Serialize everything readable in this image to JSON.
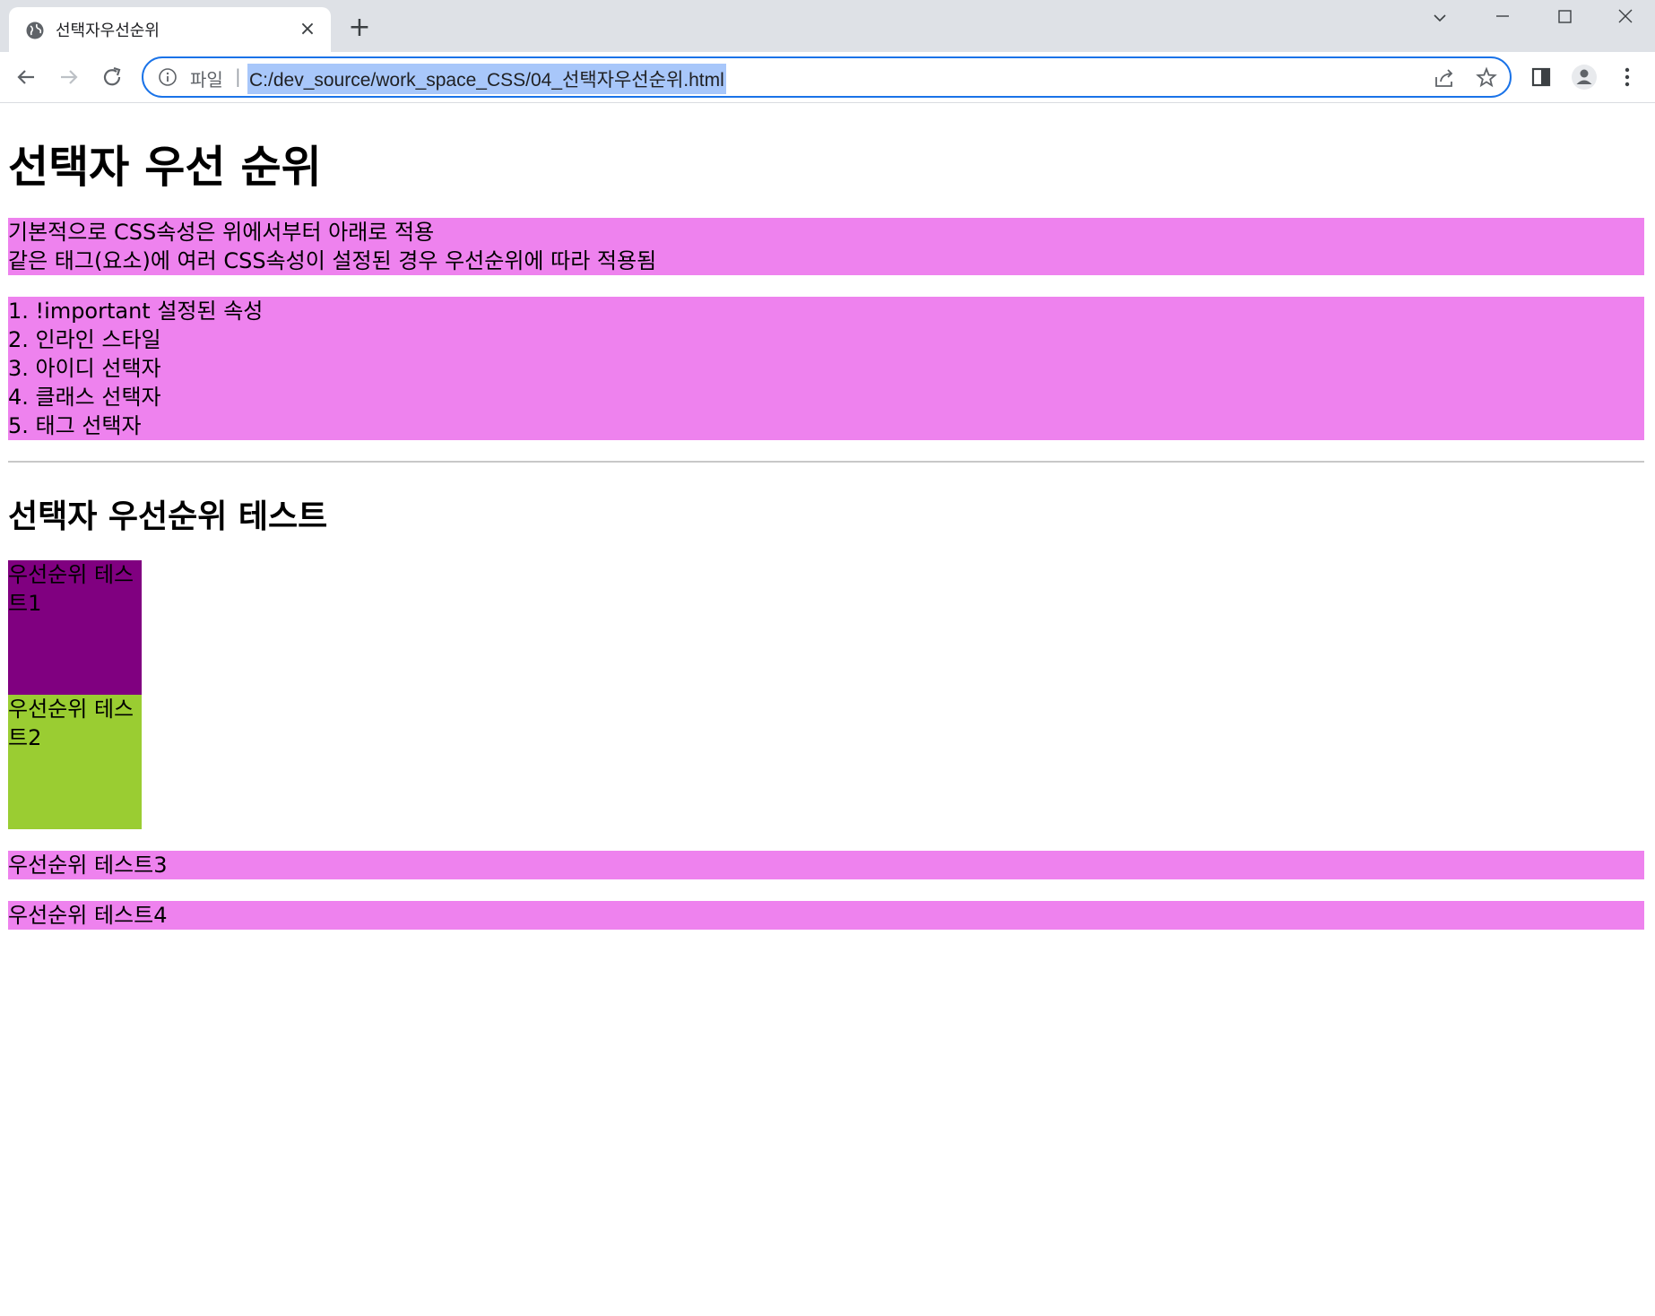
{
  "browser": {
    "tab_title": "선택자우선순위",
    "tab_close": "×",
    "new_tab": "+",
    "url_scheme_label": "파일",
    "url_separator": "|",
    "url": "C:/dev_source/work_space_CSS/04_선택자우선순위.html",
    "icons": [
      "globe-icon",
      "close-icon",
      "plus-icon",
      "tab-search-icon",
      "minimize-icon",
      "maximize-icon",
      "window-close-icon",
      "back-arrow-icon",
      "forward-arrow-icon",
      "reload-icon",
      "info-icon",
      "share-icon",
      "star-icon",
      "side-panel-icon",
      "profile-icon",
      "menu-icon"
    ],
    "accent_color": "#1a73e8"
  },
  "page": {
    "heading": "선택자 우선 순위",
    "description": [
      "기본적으로 CSS속성은 위에서부터 아래로 적용",
      "같은 태그(요소)에 여러 CSS속성이 설정된 경우 우선순위에 따라 적용됨"
    ],
    "rules": [
      "1. !important 설정된 속성",
      "2. 인라인 스타일",
      "3. 아이디 선택자",
      "4. 클래스 선택자",
      "5. 태그 선택자"
    ],
    "test_heading": "선택자 우선순위 테스트",
    "tests": [
      "우선순위 테스트1",
      "우선순위 테스트2",
      "우선순위 테스트3",
      "우선순위 테스트4"
    ],
    "colors": {
      "violet": "#ee82ee",
      "purple": "#800080",
      "yellowgreen": "#9acd32"
    }
  }
}
